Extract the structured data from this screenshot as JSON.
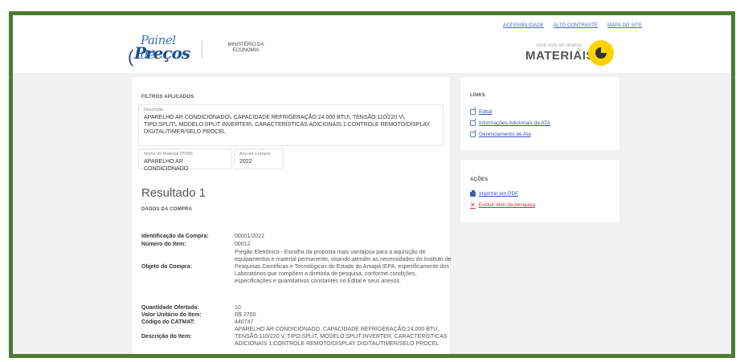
{
  "toplinks": [
    "ACESSIBILIDADE",
    "ALTO CONTRASTE",
    "MAPA DO SITE"
  ],
  "brand": {
    "line1": "Painel de",
    "line2": "Preços"
  },
  "ministry": {
    "line1": "MINISTÉRIO DA",
    "line2": "ECONOMIA"
  },
  "materiais": {
    "subtitle": "Você está em análise de",
    "title": "MATERIAIS"
  },
  "filters": {
    "title": "FILTROS APLICADOS",
    "descricao_label": "Descrição",
    "descricao_value": "APARELHO AR CONDICIONADO\\, CAPACIDADE REFRIGERAÇÃO:24.000 BTU\\, TENSÃO:110/220 V\\, TIPO:SPLIT\\, MODELO:SPLIT INVERTER\\, CARACTERÍSTICAS ADICIONAIS 1:CONTROLE REMOTO/DISPLAY DIGITAL/TIMER/SELO PROCEL",
    "nome_label": "Nome do Material (PDM)",
    "nome_value": "APARELHO AR CONDICIONADO",
    "ano_label": "Ano da Compra",
    "ano_value": "2022"
  },
  "result": {
    "title": "Resultado 1",
    "section": "DADOS DA COMPRA"
  },
  "fields": {
    "id_compra_k": "Identificação da Compra:",
    "id_compra_v": "00001/2022",
    "num_item_k": "Número do Item:",
    "num_item_v": "00012",
    "objeto_k": "Objeto da Compra:",
    "objeto_v": "Pregão Eletrônico - Escolha da proposta mais vantajosa para a aquisição de equipamentos e material permanente, visando atender as necessidades do Instituto de Pesquisas Científicas e Tecnológicas do Estado do Amapá IEPA, especificamente dos Laboratórios que compõem a diretoria de pesquisa, conforme condições, especificações e quantitativos constantes no Edital e seus anexos.",
    "qtd_k": "Quantidade Ofertada:",
    "qtd_v": "10",
    "valor_k": "Valor Unitário do Item:",
    "valor_v": "R$ 2700",
    "catmat_k": "Código do CATMAT:",
    "catmat_v": "440747",
    "desc_k": "Descrição do Item:",
    "desc_v": "APARELHO AR CONDICIONADO, CAPACIDADE REFRIGERAÇÃO:24.000 BTU, TENSÃO:110/220 V, TIPO:SPLIT, MODELO:SPLIT INVERTER, CARACTERÍSTICAS ADICIONAIS 1:CONTROLE REMOTO/DISPLAY DIGITAL/TIMER/SELO PROCEL"
  },
  "links": {
    "title": "LINKS",
    "edital": "Edital",
    "info_ata": "Informações Adicionais da ATA",
    "gerenciamento": "Gerenciamento de Ata"
  },
  "acoes": {
    "title": "AÇÕES",
    "imprimir": "Imprimir em PDF",
    "excluir": "Excluir item da pesquisa"
  },
  "colors": {
    "frame": "#4e7a34",
    "link": "#2c55b0",
    "danger": "#c8323c",
    "accent": "#ffd200"
  }
}
